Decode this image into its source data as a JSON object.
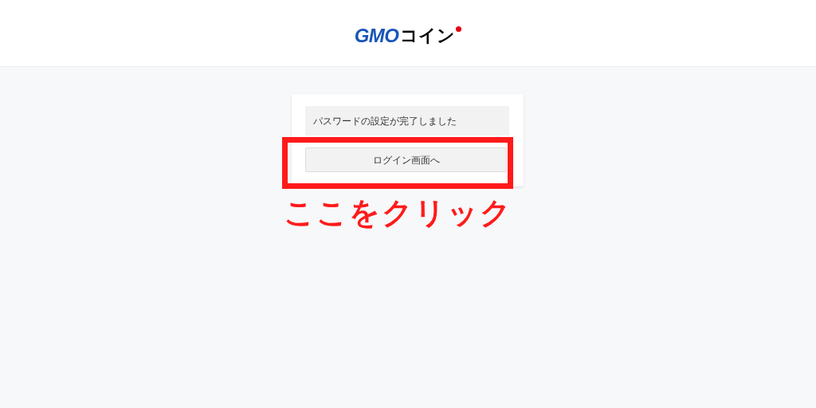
{
  "header": {
    "logo": {
      "brand": "GMO",
      "product": "コイン"
    }
  },
  "card": {
    "message": "パスワードの設定が完了しました",
    "button": "ログイン画面へ"
  },
  "annotation": {
    "text": "ここをクリック"
  }
}
